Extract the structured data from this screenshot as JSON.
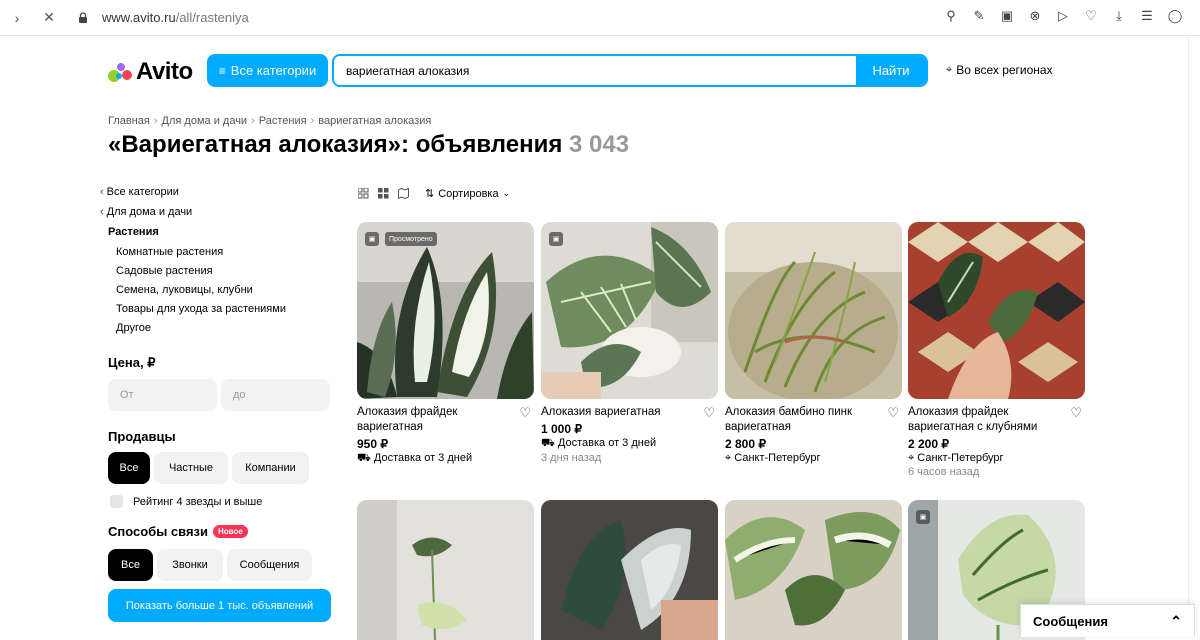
{
  "browser": {
    "url_host": "www.avito.ru",
    "url_path": "/all/rasteniya"
  },
  "header": {
    "logo_text": "Avito",
    "categories_button": "Все категории",
    "search_value": "вариегатная алоказия",
    "search_button": "Найти",
    "region": "Во всех регионах"
  },
  "breadcrumb": [
    "Главная",
    "Для дома и дачи",
    "Растения",
    "вариегатная алоказия"
  ],
  "title": {
    "text": "«Вариегатная алоказия»: объявления",
    "count": "3 043"
  },
  "sidebar": {
    "back_links": [
      "Все категории",
      "Для дома и дачи"
    ],
    "active_category": "Растения",
    "subcategories": [
      "Комнатные растения",
      "Садовые растения",
      "Семена, луковицы, клубни",
      "Товары для ухода за растениями",
      "Другое"
    ],
    "price_heading": "Цена, ₽",
    "price_from": "От",
    "price_to": "до",
    "sellers_heading": "Продавцы",
    "sellers": [
      "Все",
      "Частные",
      "Компании"
    ],
    "rating_label": "Рейтинг 4 звезды и выше",
    "contact_heading": "Способы связи",
    "contact_badge": "Новое",
    "contacts": [
      "Все",
      "Звонки",
      "Сообщения"
    ],
    "show_more": "Показать больше 1 тыс. объявлений"
  },
  "toolbar": {
    "sort_label": "Сортировка"
  },
  "cards": [
    {
      "title": "Алоказия фрайдек вариегатная",
      "price": "950 ₽",
      "meta": "Доставка от 3 дней",
      "date": "",
      "tag": "Просмотрено"
    },
    {
      "title": "Алоказия вариегатная",
      "price": "1 000 ₽",
      "meta": "Доставка от 3 дней",
      "date": "3 дня назад",
      "tag": ""
    },
    {
      "title": "Алоказия бамбино пинк вариегатная",
      "price": "2 800 ₽",
      "meta": "Санкт-Петербург",
      "date": "",
      "tag": ""
    },
    {
      "title": "Алоказия фрайдек вариегатная с клубнями",
      "price": "2 200 ₽",
      "meta": "Санкт-Петербург",
      "date": "6 часов назад",
      "tag": ""
    }
  ],
  "messages": {
    "label": "Сообщения"
  },
  "colors": {
    "accent": "#00aaff",
    "badge": "#ff3355"
  }
}
